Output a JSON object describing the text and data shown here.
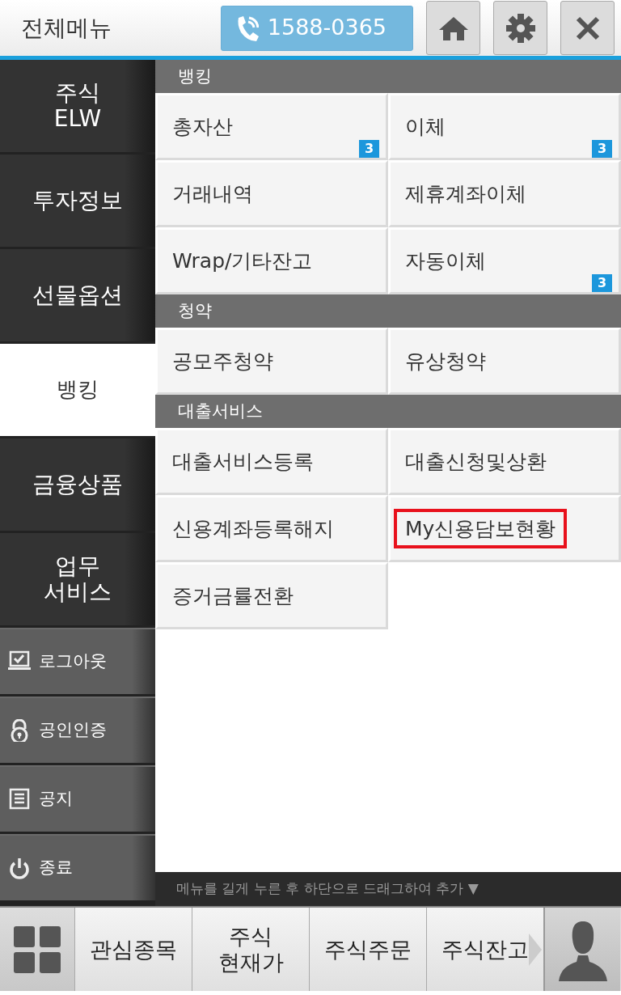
{
  "header": {
    "title": "전체메뉴",
    "phone": "1588-0365"
  },
  "categories": [
    {
      "lines": [
        "주식",
        "ELW"
      ],
      "selected": false
    },
    {
      "lines": [
        "투자정보"
      ],
      "selected": false
    },
    {
      "lines": [
        "선물옵션"
      ],
      "selected": false
    },
    {
      "lines": [
        "뱅킹"
      ],
      "selected": true
    },
    {
      "lines": [
        "금융상품"
      ],
      "selected": false
    },
    {
      "lines": [
        "업무",
        "서비스"
      ],
      "selected": false
    }
  ],
  "utilities": [
    {
      "kind": "logout",
      "label": "로그아웃"
    },
    {
      "kind": "certificate",
      "label": "공인인증"
    },
    {
      "kind": "notice",
      "label": "공지"
    },
    {
      "kind": "exit",
      "label": "종료"
    }
  ],
  "sections": [
    {
      "title": "뱅킹",
      "items": [
        {
          "label": "총자산",
          "badge": "3",
          "highlighted": false
        },
        {
          "label": "이체",
          "badge": "3",
          "highlighted": false
        },
        {
          "label": "거래내역",
          "highlighted": false
        },
        {
          "label": "제휴계좌이체",
          "highlighted": false
        },
        {
          "label": "Wrap/기타잔고",
          "highlighted": false
        },
        {
          "label": "자동이체",
          "badge": "3",
          "highlighted": false
        }
      ]
    },
    {
      "title": "청약",
      "items": [
        {
          "label": "공모주청약",
          "highlighted": false
        },
        {
          "label": "유상청약",
          "highlighted": false
        }
      ]
    },
    {
      "title": "대출서비스",
      "items": [
        {
          "label": "대출서비스등록",
          "highlighted": false
        },
        {
          "label": "대출신청및상환",
          "highlighted": false
        },
        {
          "label": "신용계좌등록해지",
          "highlighted": false
        },
        {
          "label": "My신용담보현황",
          "highlighted": true
        },
        {
          "label": "증거금률전환",
          "highlighted": false
        }
      ]
    }
  ],
  "hint": "메뉴를 길게 누른 후 하단으로 드래그하여 추가 ▼",
  "quickbar": [
    {
      "lines": [
        "관심종목"
      ]
    },
    {
      "lines": [
        "주식",
        "현재가"
      ]
    },
    {
      "lines": [
        "주식주문"
      ]
    },
    {
      "lines": [
        "주식잔고"
      ]
    }
  ]
}
